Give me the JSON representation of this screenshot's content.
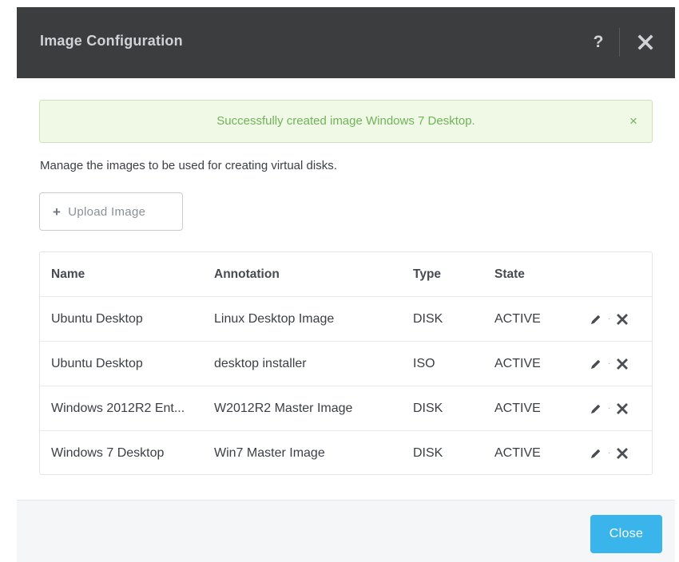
{
  "modal": {
    "title": "Image Configuration",
    "help_label": "?"
  },
  "alert": {
    "message": "Successfully created image Windows 7 Desktop.",
    "close_label": "×",
    "color": "#71b35a"
  },
  "description": "Manage the images to be used for creating virtual disks.",
  "upload": {
    "icon": "+",
    "label": "Upload Image"
  },
  "table": {
    "headers": {
      "name": "Name",
      "annotation": "Annotation",
      "type": "Type",
      "state": "State"
    },
    "rows": [
      {
        "name": "Ubuntu Desktop",
        "annotation": "Linux Desktop Image",
        "type": "DISK",
        "state": "ACTIVE"
      },
      {
        "name": "Ubuntu Desktop",
        "annotation": "desktop installer",
        "type": "ISO",
        "state": "ACTIVE"
      },
      {
        "name": "Windows 2012R2 Ent...",
        "annotation": "W2012R2 Master Image",
        "type": "DISK",
        "state": "ACTIVE"
      },
      {
        "name": "Windows 7 Desktop",
        "annotation": "Win7 Master Image",
        "type": "DISK",
        "state": "ACTIVE"
      }
    ],
    "action_separator": "·",
    "icons": {
      "edit": "pencil-icon",
      "delete": "close-icon"
    }
  },
  "footer": {
    "close_label": "Close",
    "accent": "#3ab5ec"
  },
  "colors": {
    "header_bg": "#3c3d3f",
    "alert_bg": "#f0f8e6"
  }
}
